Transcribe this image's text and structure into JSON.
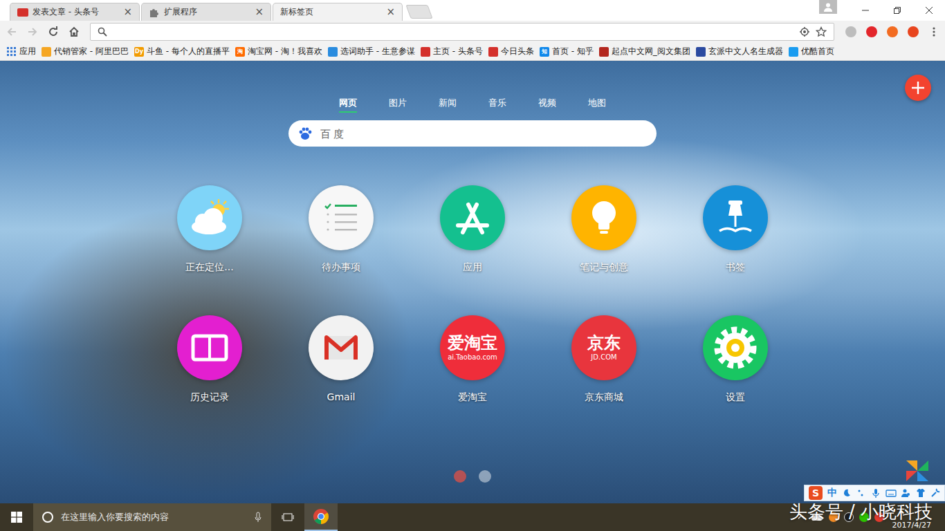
{
  "tabs": [
    {
      "label": "发表文章 - 头条号",
      "selected": false,
      "kind": "toutiao",
      "close": "×"
    },
    {
      "label": "扩展程序",
      "selected": false,
      "kind": "puzzle",
      "close": "×"
    },
    {
      "label": "新标签页",
      "selected": true,
      "kind": "none",
      "close": "×"
    }
  ],
  "nav": {
    "back_enabled": false,
    "forward_enabled": false
  },
  "omnibox": {
    "value": ""
  },
  "extensions": [
    {
      "color": "#bdbdbd"
    },
    {
      "color": "#e3262b"
    },
    {
      "color": "#f26b21"
    },
    {
      "color": "#e8451e"
    }
  ],
  "bookmarks": [
    {
      "label": "应用",
      "kind": "apps",
      "color": "#3a7bd5",
      "badge": ""
    },
    {
      "label": "代销管家 - 阿里巴巴",
      "kind": "favicon",
      "color": "#f5a623",
      "badge": ""
    },
    {
      "label": "斗鱼 - 每个人的直播平",
      "kind": "favicon",
      "color": "#f29b00",
      "badge": "Dy"
    },
    {
      "label": "淘宝网 - 淘！我喜欢",
      "kind": "favicon",
      "color": "#ff6a00",
      "badge": "淘"
    },
    {
      "label": "选词助手 - 生意参谋",
      "kind": "favicon",
      "color": "#2a8cdf",
      "badge": ""
    },
    {
      "label": "主页 - 头条号",
      "kind": "favicon",
      "color": "#d4302b",
      "badge": ""
    },
    {
      "label": "今日头条",
      "kind": "favicon",
      "color": "#d4302b",
      "badge": ""
    },
    {
      "label": "首页 - 知乎",
      "kind": "favicon",
      "color": "#0f88eb",
      "badge": "知"
    },
    {
      "label": "起点中文网_阅文集团",
      "kind": "favicon",
      "color": "#b3271f",
      "badge": ""
    },
    {
      "label": "玄派中文人名生成器",
      "kind": "favicon",
      "color": "#2b4aa0",
      "badge": ""
    },
    {
      "label": "优酷首页",
      "kind": "favicon",
      "color": "#1a9cf0",
      "badge": ""
    }
  ],
  "search_tabs": [
    {
      "label": "网页",
      "selected": true
    },
    {
      "label": "图片",
      "selected": false
    },
    {
      "label": "新闻",
      "selected": false
    },
    {
      "label": "音乐",
      "selected": false
    },
    {
      "label": "视频",
      "selected": false
    },
    {
      "label": "地图",
      "selected": false
    }
  ],
  "search": {
    "placeholder": "百 度"
  },
  "apps": [
    {
      "label": "正在定位...",
      "kind": "weather",
      "color": "#7fd4f8",
      "logo": [],
      "logo_sub": ""
    },
    {
      "label": "待办事项",
      "kind": "todo",
      "color": "#f7f7f7",
      "logo": [],
      "logo_sub": ""
    },
    {
      "label": "应用",
      "kind": "appstore",
      "color": "#14c08f",
      "logo": [],
      "logo_sub": ""
    },
    {
      "label": "笔记与创意",
      "kind": "bulb",
      "color": "#ffb400",
      "logo": [],
      "logo_sub": ""
    },
    {
      "label": "书签",
      "kind": "pin",
      "color": "#1690d8",
      "logo": [],
      "logo_sub": ""
    },
    {
      "label": "历史记录",
      "kind": "book",
      "color": "#e31fd0",
      "logo": [],
      "logo_sub": ""
    },
    {
      "label": "Gmail",
      "kind": "gmail",
      "color": "#f2f2f2",
      "logo": [],
      "logo_sub": ""
    },
    {
      "label": "爱淘宝",
      "kind": "text-logo",
      "color": "#ef2d3a",
      "logo": [
        "爱淘宝"
      ],
      "logo_sub": "ai.Taobao.com"
    },
    {
      "label": "京东商城",
      "kind": "text-logo",
      "color": "#e8353d",
      "logo": [
        "京东"
      ],
      "logo_sub": "JD.COM"
    },
    {
      "label": "设置",
      "kind": "gear",
      "color": "#19c662",
      "logo": [],
      "logo_sub": ""
    }
  ],
  "pages": [
    {
      "selected": true
    },
    {
      "selected": false
    }
  ],
  "ime": {
    "logo": "S",
    "mode": "中"
  },
  "taskbar": {
    "search_placeholder": "在这里输入你要搜索的内容",
    "date": "2017/4/27"
  },
  "watermark": "头条号 / 小晓科技"
}
